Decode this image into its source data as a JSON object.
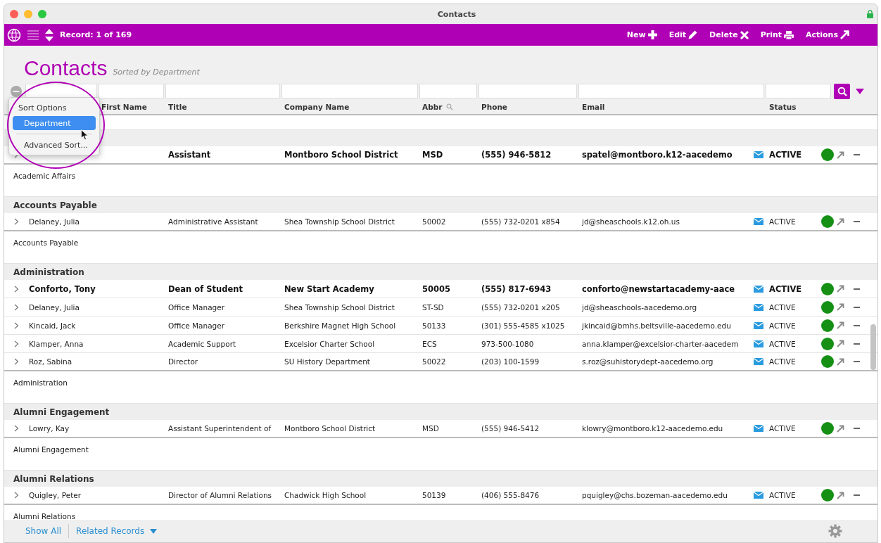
{
  "window": {
    "title": "Contacts"
  },
  "toolbar": {
    "record": "Record: 1 of 169",
    "actions": [
      {
        "label": "New"
      },
      {
        "label": "Edit"
      },
      {
        "label": "Delete"
      },
      {
        "label": "Print"
      },
      {
        "label": "Actions"
      }
    ]
  },
  "header": {
    "title": "Contacts",
    "subtitle": "Sorted by Department"
  },
  "columns": [
    {
      "label": "First Name",
      "searchable": false
    },
    {
      "label": "Title",
      "searchable": false
    },
    {
      "label": "Company Name",
      "searchable": false
    },
    {
      "label": "Abbr",
      "searchable": true
    },
    {
      "label": "Phone",
      "searchable": false
    },
    {
      "label": "Email",
      "searchable": false
    },
    {
      "label": "Status",
      "searchable": false
    }
  ],
  "sort_menu": {
    "title": "Sort Options",
    "items": [
      {
        "label": "Department",
        "selected": true
      },
      {
        "label": "Advanced Sort...",
        "selected": false
      }
    ]
  },
  "groups": [
    {
      "rows": [
        {
          "title": "Assistant",
          "company": "Montboro School District",
          "abbr": "MSD",
          "phone": "(555) 946-5812",
          "email": "spatel@montboro.k12-aacedemo",
          "status": "ACTIVE",
          "primary": true
        }
      ],
      "footer": "Academic Affairs"
    },
    {
      "label": "Accounts Payable",
      "rows": [
        {
          "name": "Delaney, Julia",
          "title": "Administrative Assistant",
          "company": "Shea Township School District",
          "abbr": "50002",
          "phone": "(555) 732-0201 x854",
          "email": "jd@sheaschools.k12.oh.us",
          "status": "ACTIVE",
          "primary": false
        }
      ],
      "footer": "Accounts Payable"
    },
    {
      "label": "Administration",
      "rows": [
        {
          "name": "Conforto, Tony",
          "title": "Dean of Student",
          "company": "New Start Academy",
          "abbr": "50005",
          "phone": "(555) 817-6943",
          "email": "conforto@newstartacademy-aace",
          "status": "ACTIVE",
          "primary": true
        },
        {
          "name": "Delaney, Julia",
          "title": "Office Manager",
          "company": "Shea Township School District",
          "abbr": "ST-SD",
          "phone": "(555) 732-0201 x205",
          "email": "jd@sheaschools-aacedemo.org",
          "status": "ACTIVE",
          "primary": false
        },
        {
          "name": "Kincaid, Jack",
          "title": "Office Manager",
          "company": "Berkshire Magnet High School",
          "abbr": "50133",
          "phone": "(301) 555-4585 x1025",
          "email": "jkincaid@bmhs.beltsville-aacedemo.edu",
          "status": "ACTIVE",
          "primary": false
        },
        {
          "name": "Klamper, Anna",
          "title": "Academic Support",
          "company": "Excelsior Charter School",
          "abbr": "ECS",
          "phone": "973-500-1080",
          "email": "anna.klamper@excelsior-charter-aacedem",
          "status": "ACTIVE",
          "primary": false
        },
        {
          "name": "Roz, Sabina",
          "title": "Director",
          "company": "SU History Department",
          "abbr": "50022",
          "phone": "(203) 100-1599",
          "email": "s.roz@suhistorydept-aacedemo.org",
          "status": "ACTIVE",
          "primary": false
        }
      ],
      "footer": "Administration"
    },
    {
      "label": "Alumni Engagement",
      "rows": [
        {
          "name": "Lowry, Kay",
          "title": "Assistant Superintendent of",
          "company": "Montboro School District",
          "abbr": "MSD",
          "phone": "(555) 946-5412",
          "email": "klowry@montboro.k12-aacedemo.edu",
          "status": "ACTIVE",
          "primary": false
        }
      ],
      "footer": "Alumni Engagement"
    },
    {
      "label": "Alumni Relations",
      "rows": [
        {
          "name": "Quigley, Peter",
          "title": "Director of Alumni Relations",
          "company": "Chadwick High School",
          "abbr": "50139",
          "phone": "(406) 555-8476",
          "email": "pquigley@chs.bozeman-aacedemo.edu",
          "status": "ACTIVE",
          "primary": false
        }
      ],
      "footer": "Alumni Relations"
    }
  ],
  "footer_bar": {
    "links": [
      {
        "label": "Show All",
        "kind": "link"
      },
      {
        "label": "Related Records",
        "kind": "dropdown"
      }
    ]
  }
}
